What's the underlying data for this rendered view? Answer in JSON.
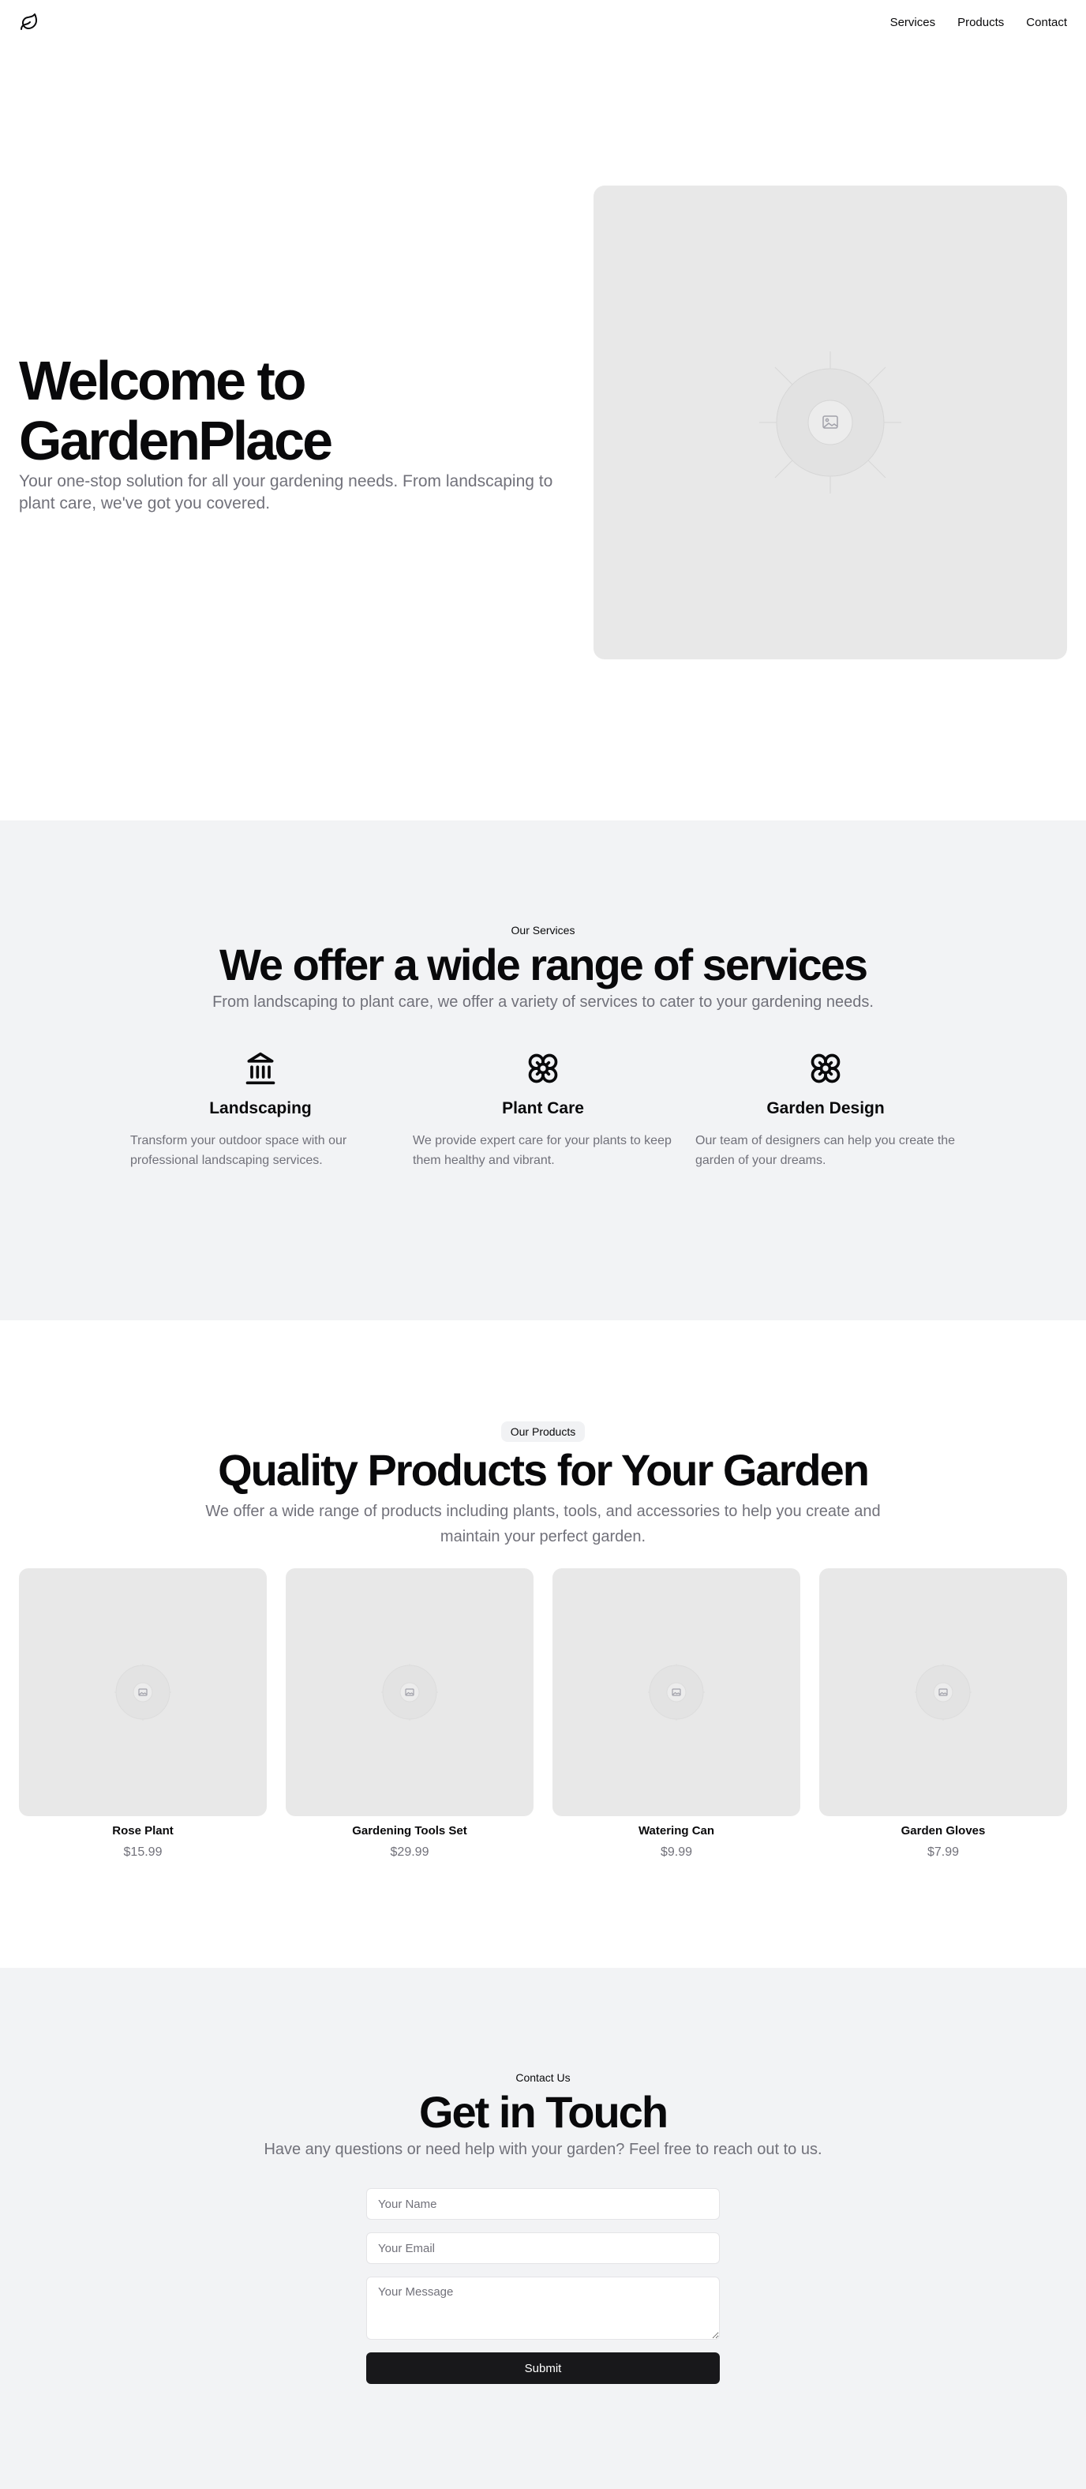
{
  "nav": {
    "services": "Services",
    "products": "Products",
    "contact": "Contact"
  },
  "hero": {
    "title": "Welcome to GardenPlace",
    "subtitle": "Your one-stop solution for all your gardening needs. From landscaping to plant care, we've got you covered."
  },
  "services": {
    "eyebrow": "Our Services",
    "title": "We offer a wide range of services",
    "subtitle": "From landscaping to plant care, we offer a variety of services to cater to your gardening needs.",
    "items": [
      {
        "icon": "landmark-icon",
        "title": "Landscaping",
        "desc": "Transform your outdoor space with our professional landscaping services."
      },
      {
        "icon": "flower-icon",
        "title": "Plant Care",
        "desc": "We provide expert care for your plants to keep them healthy and vibrant."
      },
      {
        "icon": "flower-icon",
        "title": "Garden Design",
        "desc": "Our team of designers can help you create the garden of your dreams."
      }
    ]
  },
  "products": {
    "eyebrow": "Our Products",
    "title": "Quality Products for Your Garden",
    "subtitle": "We offer a wide range of products including plants, tools, and accessories to help you create and maintain your perfect garden.",
    "items": [
      {
        "name": "Rose Plant",
        "price": "$15.99"
      },
      {
        "name": "Gardening Tools Set",
        "price": "$29.99"
      },
      {
        "name": "Watering Can",
        "price": "$9.99"
      },
      {
        "name": "Garden Gloves",
        "price": "$7.99"
      }
    ]
  },
  "contact": {
    "eyebrow": "Contact Us",
    "title": "Get in Touch",
    "subtitle": "Have any questions or need help with your garden? Feel free to reach out to us.",
    "name_placeholder": "Your Name",
    "email_placeholder": "Your Email",
    "message_placeholder": "Your Message",
    "submit_label": "Submit"
  },
  "colors": {
    "accent": "#18181b",
    "muted": "#71717a",
    "section_bg": "#f2f3f5",
    "placeholder_bg": "#e8e8e8"
  }
}
